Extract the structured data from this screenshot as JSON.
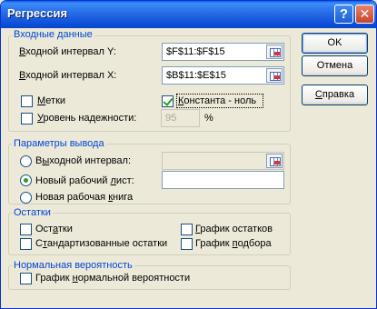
{
  "window": {
    "title": "Регрессия",
    "help_glyph": "?",
    "close_glyph": "✕"
  },
  "input": {
    "legend": "Входные данные",
    "y_label_ul": "В",
    "y_label_rest": "ходной интервал Y:",
    "y_value": "$F$11:$F$15",
    "x_label_ul": "В",
    "x_label_rest": "ходной интервал X:",
    "x_value": "$B$11:$E$15",
    "labels_ul": "М",
    "labels_rest": "етки",
    "labels_checked": false,
    "constant_ul": "К",
    "constant_rest": "онстанта - ноль",
    "constant_checked": true,
    "confidence_ul": "У",
    "confidence_rest": "ровень надежности:",
    "confidence_checked": false,
    "confidence_value": "95",
    "percent": "%"
  },
  "output": {
    "legend": "Параметры вывода",
    "range_pre": "В",
    "range_ul": "ы",
    "range_post": "ходной интервал:",
    "range_value": "",
    "sheet_pre": "Новый рабочий ",
    "sheet_ul": "л",
    "sheet_post": "ист:",
    "sheet_value": "",
    "book_pre": "Новая рабочая ",
    "book_ul": "к",
    "book_post": "нига",
    "selected": "sheet"
  },
  "residuals": {
    "legend": "Остатки",
    "residuals_pre": "Ост",
    "residuals_ul": "а",
    "residuals_post": "тки",
    "standardized_pre": "С",
    "standardized_ul": "т",
    "standardized_post": "андартизованные остатки",
    "residual_plot_pre": "",
    "residual_plot_ul": "Г",
    "residual_plot_post": "рафик остатков",
    "fit_plot_pre": "График ",
    "fit_plot_ul": "п",
    "fit_plot_post": "одбора"
  },
  "normal": {
    "legend": "Нормальная вероятность",
    "plot_pre": "График ",
    "plot_ul": "н",
    "plot_post": "ормальной вероятности"
  },
  "buttons": {
    "ok": "OK",
    "cancel": "Отмена",
    "help_pre": "",
    "help_ul": "С",
    "help_post": "правка"
  }
}
